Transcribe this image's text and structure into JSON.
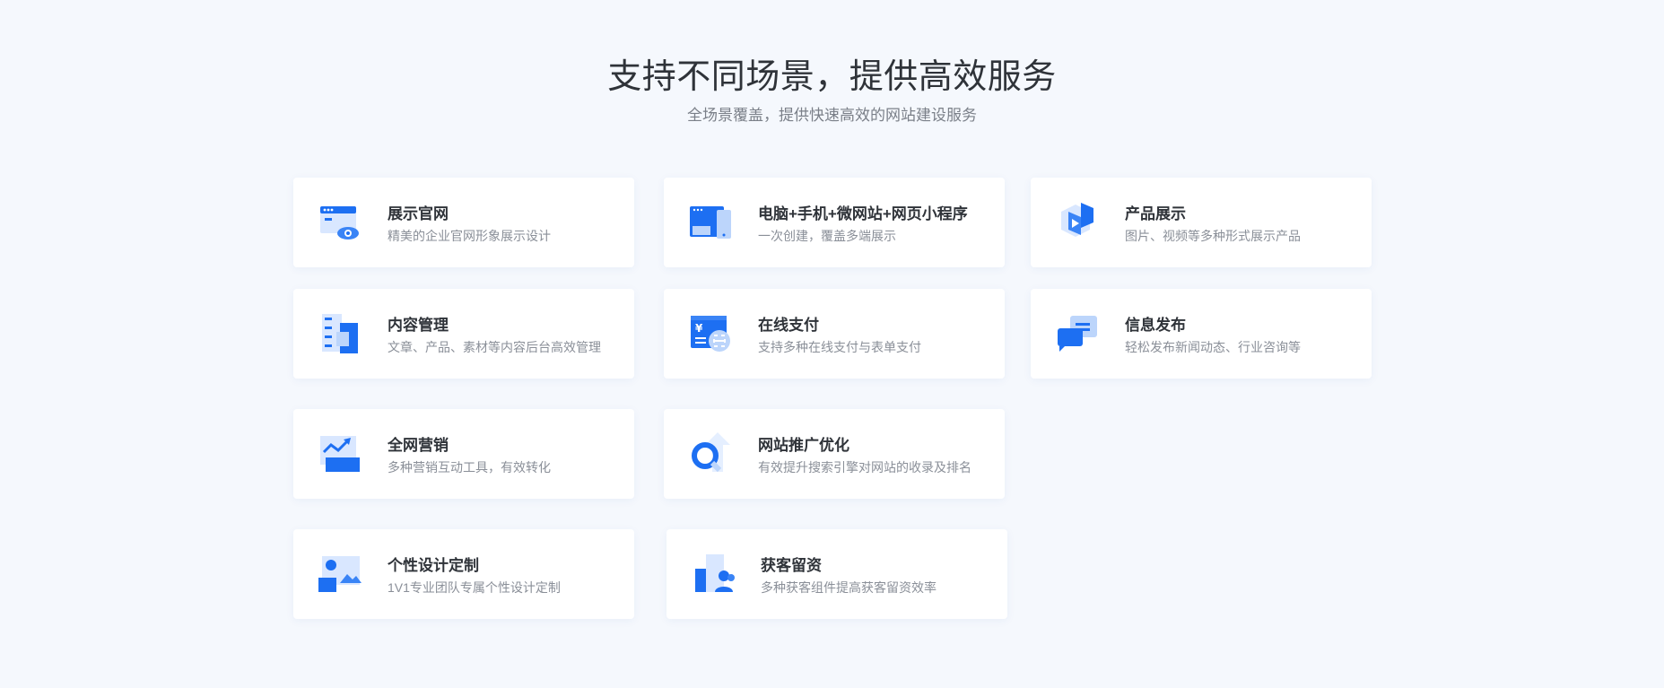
{
  "header": {
    "title": "支持不同场景，提供高效服务",
    "subtitle": "全场景覆盖，提供快速高效的网站建设服务"
  },
  "colors": {
    "primary": "#1d6ff2",
    "light": "#bcd5fb",
    "pale": "#e5efff"
  },
  "cards": [
    {
      "title": "展示官网",
      "desc": "精美的企业官网形象展示设计",
      "icon": "browser-eye-icon"
    },
    {
      "title": "电脑+手机+微网站+网页小程序",
      "desc": "一次创建，覆盖多端展示",
      "icon": "devices-icon"
    },
    {
      "title": "产品展示",
      "desc": "图片、视频等多种形式展示产品",
      "icon": "video-cube-icon"
    },
    {
      "title": "内容管理",
      "desc": "文章、产品、素材等内容后台高效管理",
      "icon": "content-stack-icon"
    },
    {
      "title": "在线支付",
      "desc": "支持多种在线支付与表单支付",
      "icon": "payment-yen-icon"
    },
    {
      "title": "信息发布",
      "desc": "轻松发布新闻动态、行业咨询等",
      "icon": "chat-bubbles-icon"
    },
    {
      "title": "全网营销",
      "desc": "多种营销互动工具，有效转化",
      "icon": "trend-chart-icon"
    },
    {
      "title": "网站推广优化",
      "desc": "有效提升搜索引擎对网站的收录及排名",
      "icon": "search-arrow-icon"
    },
    {
      "title": "个性设计定制",
      "desc": "1V1专业团队专属个性设计定制",
      "icon": "custom-design-icon"
    },
    {
      "title": "获客留资",
      "desc": "多种获客组件提高获客留资效率",
      "icon": "users-building-icon"
    }
  ]
}
